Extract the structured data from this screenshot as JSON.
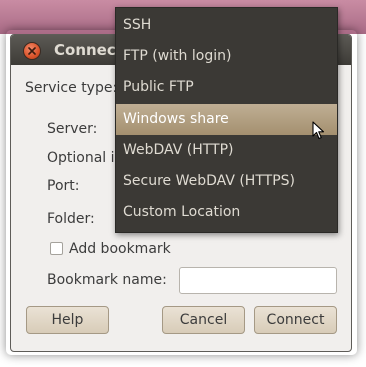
{
  "window": {
    "title": "Connect"
  },
  "form": {
    "service_type_label": "Service type:",
    "server_label": "Server:",
    "optional_label": "Optional in",
    "port_label": "Port:",
    "folder_label": "Folder:",
    "add_bookmark_label": "Add bookmark",
    "add_bookmark_checked": false,
    "bookmark_name_label": "Bookmark name:",
    "bookmark_name_value": ""
  },
  "buttons": {
    "help": "Help",
    "cancel": "Cancel",
    "connect": "Connect"
  },
  "dropdown": {
    "selected": "Windows share",
    "items": [
      "SSH",
      "FTP (with login)",
      "Public FTP",
      "Windows share",
      "WebDAV (HTTP)",
      "Secure WebDAV (HTTPS)",
      "Custom Location"
    ]
  },
  "colors": {
    "titlebar": "#3d3b37",
    "menu_bg": "#3b3935",
    "menu_selected": "#b3a082",
    "close_button": "#d9532a"
  },
  "icons": [
    "close-icon",
    "mouse-pointer-icon"
  ]
}
